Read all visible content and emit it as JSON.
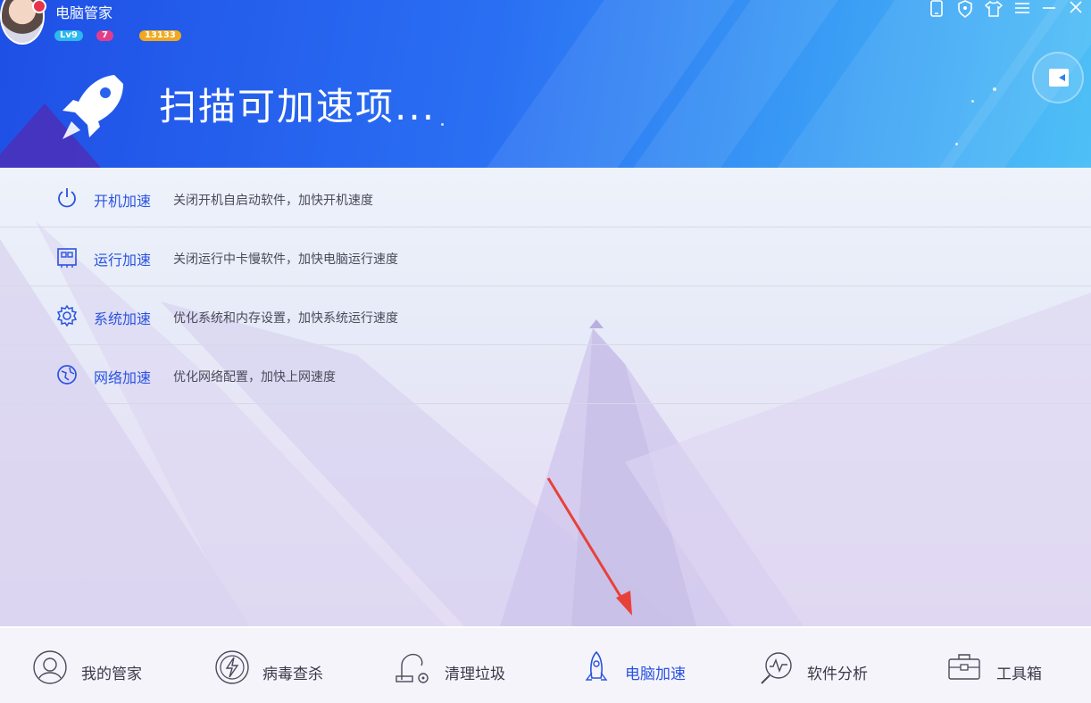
{
  "app": {
    "title": "电脑管家",
    "level_badge": "Lv9",
    "message_badge": "7",
    "coin_badge": "13133"
  },
  "window_controls": [
    "phone-icon",
    "shield-icon",
    "shirt-icon",
    "menu-icon",
    "minimize-icon",
    "close-icon"
  ],
  "header": {
    "title": "扫描可加速项..."
  },
  "speedup_items": [
    {
      "label": "开机加速",
      "desc": "关闭开机自启动软件，加快开机速度",
      "icon": "power-icon"
    },
    {
      "label": "运行加速",
      "desc": "关闭运行中卡慢软件，加快电脑运行速度",
      "icon": "memory-chip-icon"
    },
    {
      "label": "系统加速",
      "desc": "优化系统和内存设置，加快系统运行速度",
      "icon": "gear-icon"
    },
    {
      "label": "网络加速",
      "desc": "优化网络配置，加快上网速度",
      "icon": "network-globe-icon"
    }
  ],
  "nav": [
    {
      "label": "我的管家",
      "icon": "butler-avatar-icon"
    },
    {
      "label": "病毒查杀",
      "icon": "lightning-shield-icon"
    },
    {
      "label": "清理垃圾",
      "icon": "vacuum-cleaner-icon"
    },
    {
      "label": "电脑加速",
      "icon": "rocket-icon",
      "active": true
    },
    {
      "label": "软件分析",
      "icon": "magnifier-chart-icon"
    },
    {
      "label": "工具箱",
      "icon": "toolbox-icon"
    }
  ],
  "colors": {
    "accent": "#2a53e0",
    "header_start": "#1f4fe6",
    "header_end": "#4fc0f6",
    "annotation_arrow": "#e8413a"
  }
}
